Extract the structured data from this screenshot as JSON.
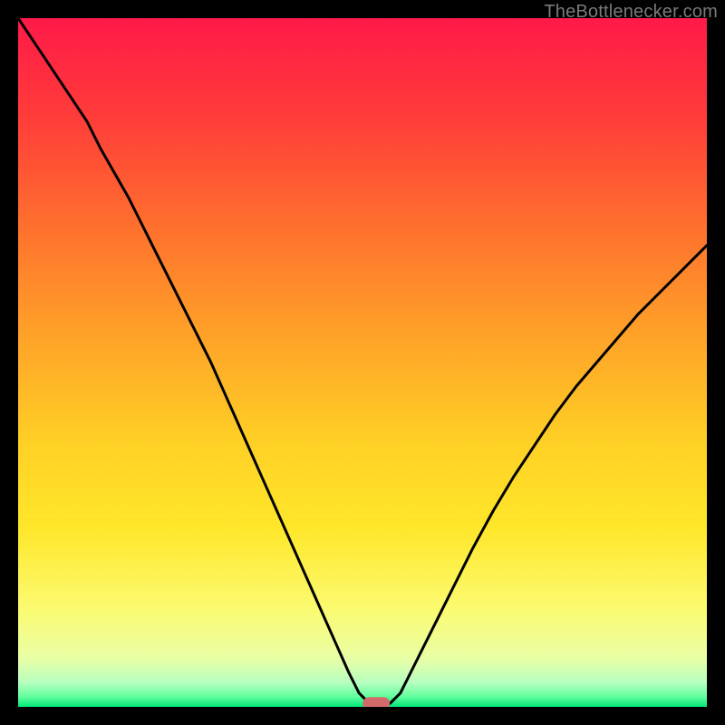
{
  "attribution": "TheBottlenecker.com",
  "chart_data": {
    "type": "line",
    "title": "",
    "xlabel": "",
    "ylabel": "",
    "xlim": [
      0,
      100
    ],
    "ylim": [
      0,
      100
    ],
    "background_gradient": {
      "stops": [
        {
          "offset": 0.0,
          "color": "#ff1a48"
        },
        {
          "offset": 0.14,
          "color": "#ff3b3a"
        },
        {
          "offset": 0.3,
          "color": "#ff6f2e"
        },
        {
          "offset": 0.46,
          "color": "#ffa228"
        },
        {
          "offset": 0.62,
          "color": "#ffd126"
        },
        {
          "offset": 0.74,
          "color": "#ffe72a"
        },
        {
          "offset": 0.86,
          "color": "#fbfb72"
        },
        {
          "offset": 0.93,
          "color": "#e9ffa6"
        },
        {
          "offset": 0.965,
          "color": "#b6ffc0"
        },
        {
          "offset": 0.985,
          "color": "#63ff9e"
        },
        {
          "offset": 1.0,
          "color": "#00e77a"
        }
      ]
    },
    "series": [
      {
        "name": "bottleneck-curve",
        "x": [
          0,
          2,
          4,
          6,
          8,
          10,
          12,
          14,
          16,
          18,
          20,
          22,
          24,
          26,
          28,
          30,
          32,
          34,
          36,
          38,
          40,
          42,
          44,
          46,
          48,
          49.5,
          51,
          52.5,
          54,
          55.5,
          57,
          60,
          63,
          66,
          69,
          72,
          75,
          78,
          81,
          84,
          87,
          90,
          93,
          96,
          100
        ],
        "y": [
          100,
          97,
          94,
          91,
          88,
          85,
          81,
          77.5,
          74,
          70,
          66,
          62,
          58,
          54,
          50,
          45.5,
          41,
          36.5,
          32,
          27.5,
          23,
          18.5,
          14,
          9.5,
          5,
          2,
          0.5,
          0.5,
          0.5,
          2,
          5,
          11,
          17,
          23,
          28.5,
          33.5,
          38,
          42.5,
          46.5,
          50,
          53.5,
          57,
          60,
          63,
          67
        ]
      }
    ],
    "marker": {
      "name": "optimal-marker",
      "x": 52,
      "y": 0.5,
      "color": "#d16a6a"
    }
  }
}
